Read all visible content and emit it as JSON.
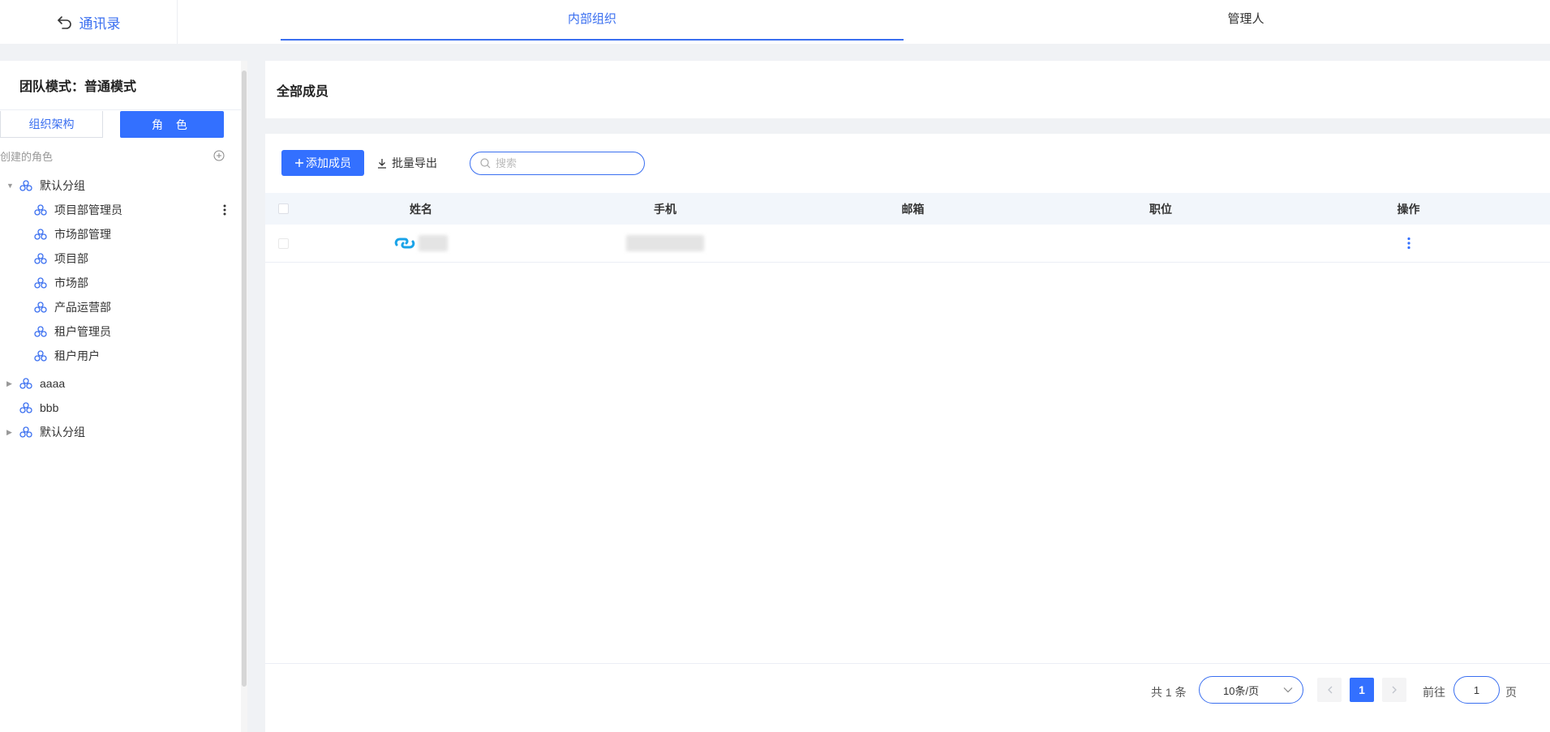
{
  "topbar": {
    "back_label": "通讯录",
    "tabs": [
      {
        "label": "内部组织",
        "active": true
      },
      {
        "label": "管理人",
        "active": false
      }
    ]
  },
  "sidebar": {
    "team_mode": "团队模式：普通模式",
    "tabs": [
      {
        "label": "组织架构",
        "active": false
      },
      {
        "label": "角 色",
        "active": true
      }
    ],
    "section_label": "创建的角色",
    "groups": [
      {
        "label": "默认分组",
        "expanded": true,
        "children": [
          "项目部管理员",
          "市场部管理",
          "项目部",
          "市场部",
          "产品运营部",
          "租户管理员",
          "租户用户"
        ]
      },
      {
        "label": "aaaa",
        "expanded": false,
        "has_children": true
      },
      {
        "label": "bbb",
        "expanded": false,
        "has_children": false
      },
      {
        "label": "默认分组",
        "expanded": false,
        "has_children": true
      }
    ]
  },
  "main": {
    "title": "全部成员",
    "toolbar": {
      "add_label": "添加成员",
      "export_label": "批量导出",
      "search_placeholder": "搜索"
    },
    "table": {
      "columns": [
        "姓名",
        "手机",
        "邮箱",
        "职位",
        "操作"
      ],
      "rows": [
        {
          "name": "",
          "phone": "",
          "email": "",
          "position": ""
        }
      ]
    },
    "pagination": {
      "total": "共 1 条",
      "page_size": "10条/页",
      "current_page": "1",
      "goto_label": "前往",
      "goto_value": "1",
      "page_suffix": "页"
    }
  },
  "colors": {
    "accent": "#3370ff",
    "link": "#3a6ff0",
    "header_bg": "#f2f6fb",
    "page_bg": "#f0f2f5"
  }
}
